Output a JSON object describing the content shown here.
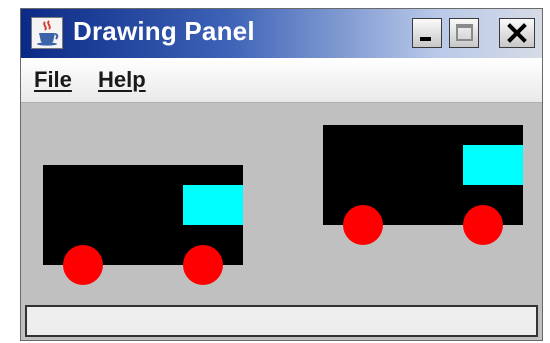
{
  "window": {
    "title": "Drawing Panel",
    "app_icon": "java-coffee-cup-icon",
    "controls": {
      "minimize_icon": "minimize-icon",
      "maximize_icon": "maximize-icon",
      "close_icon": "close-icon"
    }
  },
  "menu": {
    "items": [
      {
        "label": "File"
      },
      {
        "label": "Help"
      }
    ]
  },
  "canvas": {
    "background": "#c0c0c0",
    "colors": {
      "body": "#000000",
      "window": "#00ffff",
      "wheel": "#ff0000"
    }
  },
  "statusbar": {
    "text": ""
  }
}
